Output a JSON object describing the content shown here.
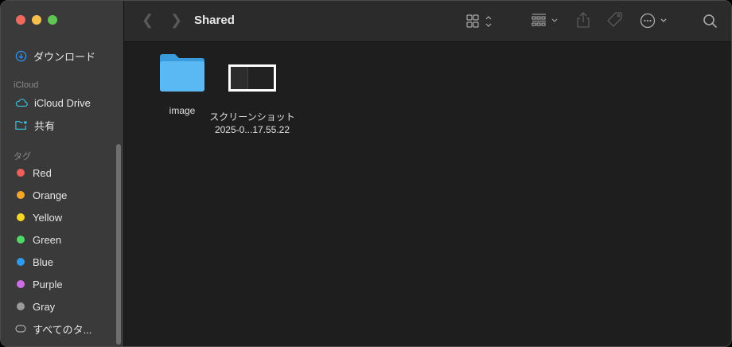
{
  "window": {
    "title": "Shared"
  },
  "sidebar": {
    "top_items": [
      {
        "label": "ダウンロード",
        "icon": "download-icon"
      }
    ],
    "icloud": {
      "header": "iCloud",
      "items": [
        {
          "label": "iCloud Drive",
          "icon": "cloud-icon"
        },
        {
          "label": "共有",
          "icon": "shared-folder-icon"
        }
      ]
    },
    "tags": {
      "header": "タグ",
      "items": [
        {
          "label": "Red",
          "color": "#ec5f5a"
        },
        {
          "label": "Orange",
          "color": "#f5a623"
        },
        {
          "label": "Yellow",
          "color": "#f7d722"
        },
        {
          "label": "Green",
          "color": "#4cd964"
        },
        {
          "label": "Blue",
          "color": "#2f9bf0"
        },
        {
          "label": "Purple",
          "color": "#cf6de6"
        },
        {
          "label": "Gray",
          "color": "#9a9a9a"
        },
        {
          "label": "すべてのタ...",
          "icon": "all-tags-icon"
        }
      ]
    }
  },
  "files": [
    {
      "name": "image",
      "type": "folder"
    },
    {
      "name_line1": "スクリーンショット",
      "name_line2": "2025-0...17.55.22",
      "type": "screenshot"
    }
  ]
}
